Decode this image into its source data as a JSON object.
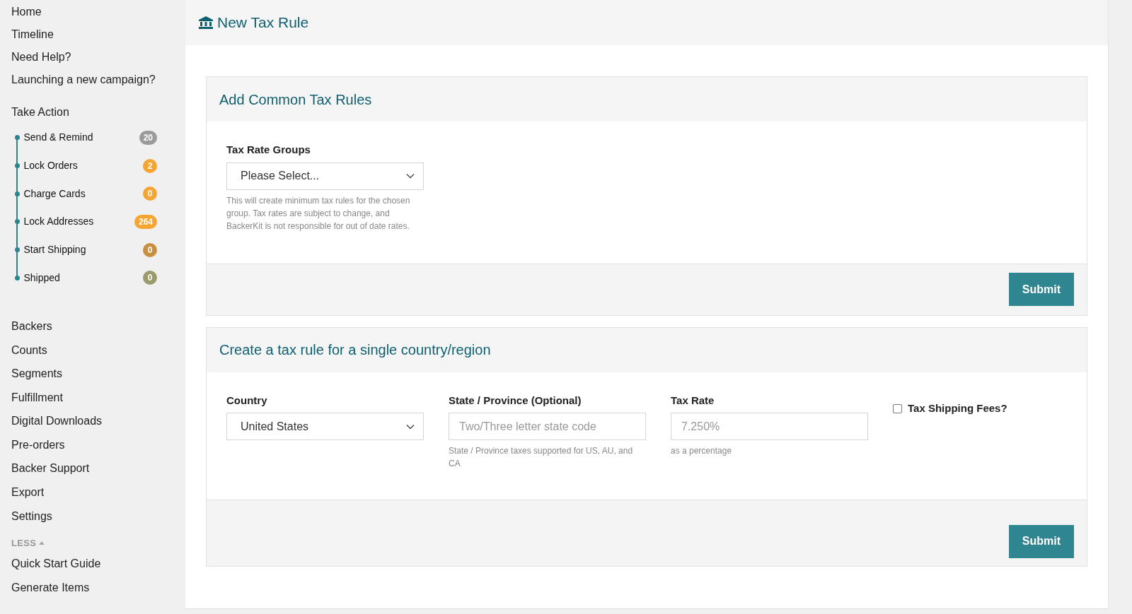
{
  "sidebar": {
    "top_items": [
      "Home",
      "Timeline",
      "Need Help?",
      "Launching a new campaign?"
    ],
    "section_title": "Take Action",
    "steps": [
      {
        "label": "Send & Remind",
        "count": "20",
        "color": "#9b9b9b"
      },
      {
        "label": "Lock Orders",
        "count": "2",
        "color": "#f5a530"
      },
      {
        "label": "Charge Cards",
        "count": "0",
        "color": "#f5a530"
      },
      {
        "label": "Lock Addresses",
        "count": "264",
        "color": "#f5a530"
      },
      {
        "label": "Start Shipping",
        "count": "0",
        "color": "#c98f40"
      },
      {
        "label": "Shipped",
        "count": "0",
        "color": "#9a9a6a"
      }
    ],
    "items": [
      "Backers",
      "Counts",
      "Segments",
      "Fulfillment",
      "Digital Downloads",
      "Pre-orders",
      "Backer Support",
      "Export",
      "Settings"
    ],
    "toggle": "LESS",
    "more_items": [
      "Quick Start Guide",
      "Generate Items"
    ]
  },
  "page_title": "New Tax Rule",
  "common_card": {
    "title": "Add Common Tax Rules",
    "label": "Tax Rate Groups",
    "select": "Please Select...",
    "help": "This will create minimum tax rules for the chosen group. Tax rates are subject to change, and BackerKit is not responsible for out of date rates.",
    "submit": "Submit"
  },
  "single_card": {
    "title": "Create a tax rule for a single country/region",
    "country": {
      "label": "Country",
      "value": "United States"
    },
    "state": {
      "label": "State / Province (Optional)",
      "placeholder": "Two/Three letter state code",
      "help": "State / Province taxes supported for US, AU, and CA"
    },
    "rate": {
      "label": "Tax Rate",
      "placeholder": "7.250%",
      "help": "as a percentage"
    },
    "shipping": {
      "label": "Tax Shipping Fees?",
      "checked": false
    },
    "submit": "Submit"
  }
}
